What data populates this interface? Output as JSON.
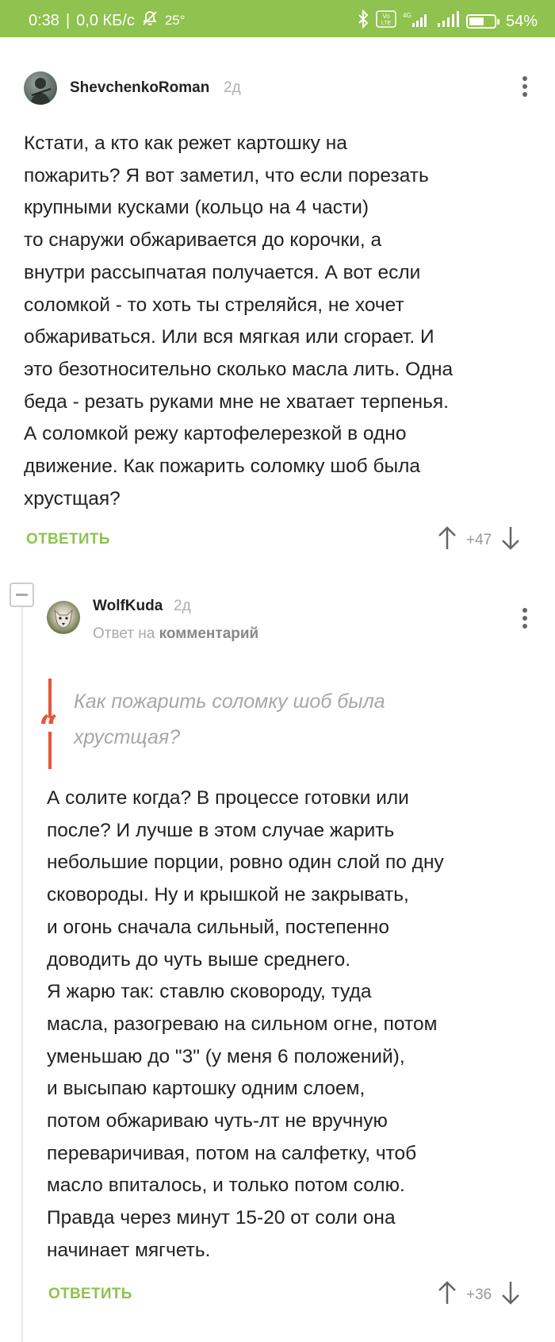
{
  "status_bar": {
    "time": "0:38",
    "separator": "|",
    "speed": "0,0 КБ/с",
    "temp": "25°",
    "battery": "54%",
    "volte": "Vo LTE",
    "network": "4G"
  },
  "comment1": {
    "username": "ShevchenkoRoman",
    "age": "2д",
    "text": "Кстати, а кто как режет картошку на\nпожарить? Я вот заметил, что если порезать\nкрупными кусками (кольцо на 4 части)\nто снаружи обжаривается до корочки, а\nвнутри рассыпчатая получается. А вот если\nсоломкой - то хоть ты стреляйся, не хочет\nобжариваться. Или вся мягкая или сгорает. И\nэто безотносительно сколько масла лить. Одна\nбеда - резать руками мне не хватает терпенья.\nА соломкой режу картофелерезкой в одно\nдвижение. Как пожарить соломку шоб была\nхрустщая?",
    "reply_label": "ОТВЕТИТЬ",
    "score": "+47"
  },
  "comment2": {
    "username": "WolfKuda",
    "age": "2д",
    "reply_prefix": "Ответ на",
    "reply_target": "комментарий",
    "quote": "Как пожарить соломку шоб была\nхрустщая?",
    "text": "А солите когда? В процессе готовки или\nпосле? И лучше в этом случае жарить\nнебольшие порции, ровно один слой по дну\nсковороды. Ну и крышкой не закрывать,\nи огонь сначала сильный, постепенно\nдоводить до чуть выше среднего.\nЯ жарю так: ставлю сковороду, туда\nмасла, разогреваю на сильном огне, потом\nуменьшаю до \"3\" (у меня 6 положений),\nи высыпаю картошку одним слоем,\nпотом обжариваю чуть-лт не вручную\nпереваричивая, потом на салфетку, чтоб\nмасло впиталось, и только потом солю.\nПравда через минут 15-20 от соли она\nначинает мягчеть.",
    "reply_label": "ОТВЕТИТЬ",
    "score": "+36"
  },
  "colors": {
    "accent_green": "#8fc24e",
    "quote_red": "#e8543a"
  }
}
